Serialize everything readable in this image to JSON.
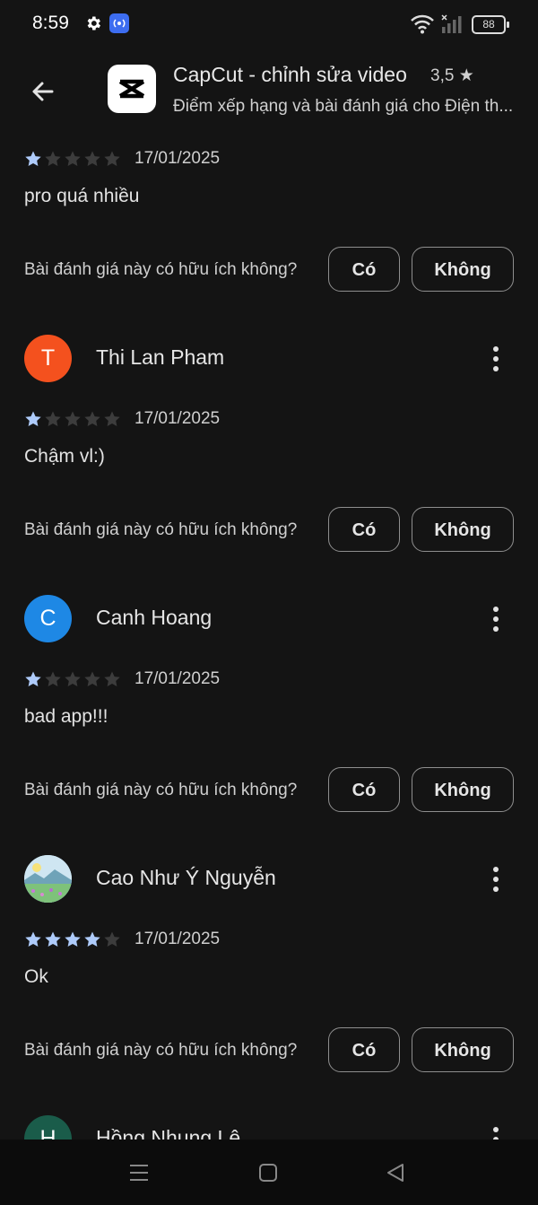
{
  "status": {
    "time": "8:59",
    "battery": "88"
  },
  "app": {
    "title": "CapCut - chỉnh sửa video",
    "rating": "3,5 ★",
    "subtitle": "Điểm xếp hạng và bài đánh giá cho Điện th..."
  },
  "top_review": {
    "rating": 1,
    "date": "17/01/2025",
    "text": "pro quá nhiều",
    "helpful_question": "Bài đánh giá này có hữu ích không?",
    "yes_label": "Có",
    "no_label": "Không"
  },
  "reviews": [
    {
      "initial": "T",
      "avatar_color": "#f4511e",
      "author": "Thi Lan Pham",
      "rating": 1,
      "date": "17/01/2025",
      "text": "Chậm vl:)",
      "helpful_question": "Bài đánh giá này có hữu ích không?",
      "yes_label": "Có",
      "no_label": "Không"
    },
    {
      "initial": "C",
      "avatar_color": "#1e88e5",
      "author": "Canh Hoang",
      "rating": 1,
      "date": "17/01/2025",
      "text": "bad app!!!",
      "helpful_question": "Bài đánh giá này có hữu ích không?",
      "yes_label": "Có",
      "no_label": "Không"
    },
    {
      "initial": "",
      "avatar_color": "#9ec5d8",
      "author": "Cao Như Ý Nguyễn",
      "rating": 4,
      "date": "17/01/2025",
      "text": "Ok",
      "helpful_question": "Bài đánh giá này có hữu ích không?",
      "yes_label": "Có",
      "no_label": "Không"
    },
    {
      "initial": "H",
      "avatar_color": "#1a5c4a",
      "author": "Hồng Nhung Lê"
    }
  ],
  "colors": {
    "star_filled": "#aecbfa",
    "star_empty": "#3c3c3c",
    "background": "#141414"
  }
}
